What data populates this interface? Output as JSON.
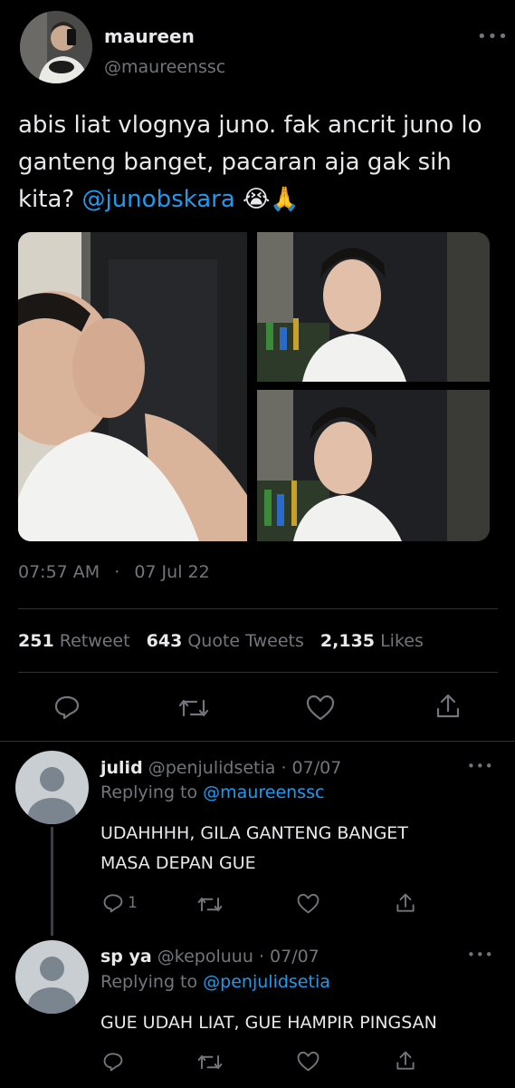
{
  "tweet": {
    "author": {
      "name": "maureen",
      "handle": "@maureenssc",
      "avatar": "profile-photo"
    },
    "text_line1": "abis liat vlognya juno. fak ancrit juno lo",
    "text_line2": "ganteng banget, pacaran aja gak sih",
    "text_line3_prefix": "kita?",
    "mention": "@junobskara",
    "emojis": "😭🙏",
    "time": "07:57 AM",
    "separator": "·",
    "date": "07 Jul 22",
    "stats": {
      "retweets": "251",
      "retweets_label": "Retweet",
      "quotes": "643",
      "quotes_label": "Quote Tweets",
      "likes": "2,135",
      "likes_label": "Likes"
    },
    "more_icon": "more-dots-icon"
  },
  "replies": [
    {
      "name": "julid",
      "handle": "@penjulidsetia",
      "date": "· 07/07",
      "replying_prefix": "Replying to",
      "replying_to": "@maureenssc",
      "line1": "UDAHHHH, GILA GANTENG BANGET",
      "line2": "MASA DEPAN GUE",
      "reply_count": "1"
    },
    {
      "name": "sp ya",
      "handle": "@kepoluuu",
      "date": "· 07/07",
      "replying_prefix": "Replying to",
      "replying_to": "@penjulidsetia",
      "line1": "GUE UDAH LIAT, GUE HAMPIR PINGSAN"
    }
  ],
  "colors": {
    "background": "#000000",
    "text": "#e7e9ea",
    "muted": "#71767b",
    "link": "#1d9bf0",
    "divider": "#2f3336"
  }
}
